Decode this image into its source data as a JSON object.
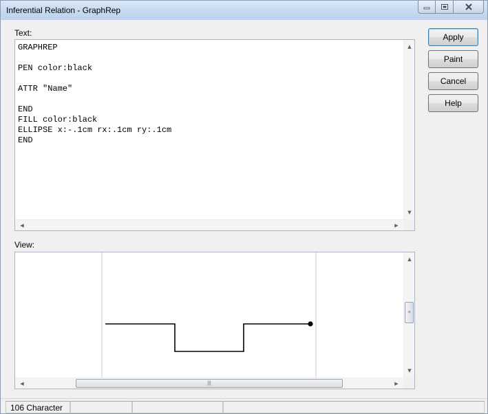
{
  "window": {
    "title": "Inferential Relation - GraphRep",
    "controls": {
      "minimize_icon": "minimize-icon",
      "maximize_icon": "maximize-icon",
      "close_icon": "close-icon"
    }
  },
  "text_section": {
    "label": "Text:",
    "lines": [
      "GRAPHREP",
      "",
      "PEN color:black",
      "",
      "ATTR \"Name\"",
      "",
      "END",
      "FILL color:black",
      "ELLIPSE x:-.1cm rx:.1cm ry:.1cm",
      "END"
    ]
  },
  "view_section": {
    "label": "View:",
    "shape_color": "#000000"
  },
  "buttons": {
    "apply": "Apply",
    "paint": "Paint",
    "cancel": "Cancel",
    "help": "Help"
  },
  "status": {
    "char_count": "106 Character"
  },
  "colors": {
    "panel_border": "#a9b6c6",
    "titlebar": "#c9dcf1"
  }
}
